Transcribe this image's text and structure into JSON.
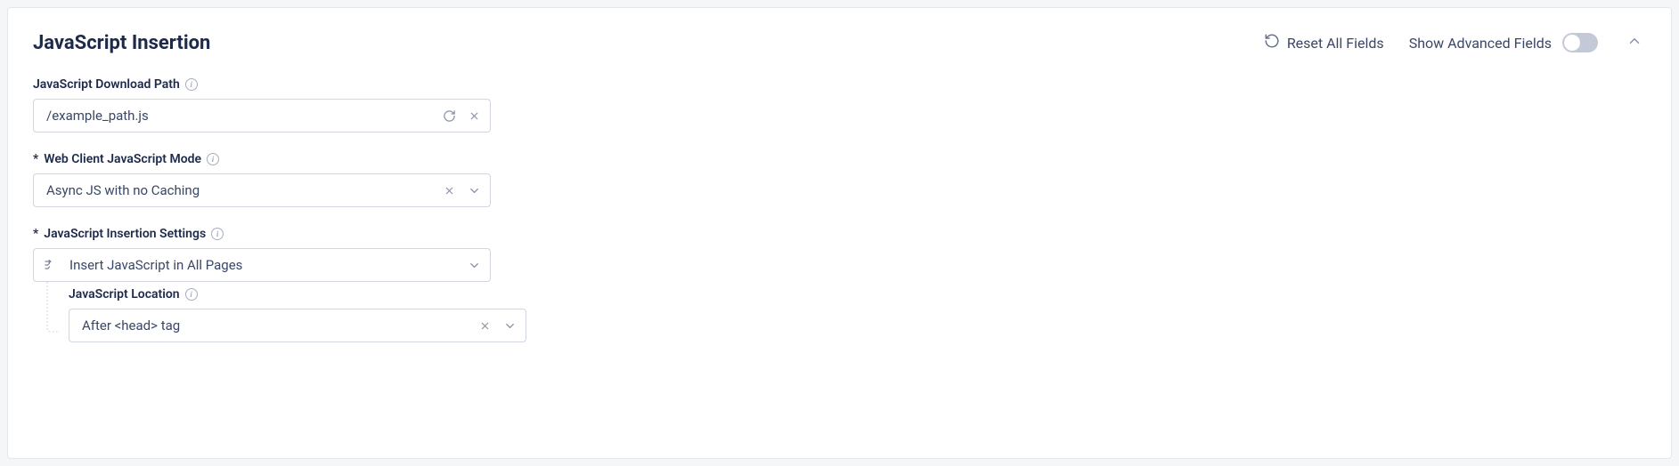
{
  "panel": {
    "title": "JavaScript Insertion",
    "reset_label": "Reset All Fields",
    "advanced_label": "Show Advanced Fields"
  },
  "fields": {
    "download_path": {
      "label": "JavaScript Download Path",
      "value": "/example_path.js"
    },
    "js_mode": {
      "label": "Web Client JavaScript Mode",
      "value": "Async JS with no Caching"
    },
    "insertion_settings": {
      "label": "JavaScript Insertion Settings",
      "value": "Insert JavaScript in All Pages"
    },
    "js_location": {
      "label": "JavaScript Location",
      "value": "After <head> tag"
    }
  }
}
